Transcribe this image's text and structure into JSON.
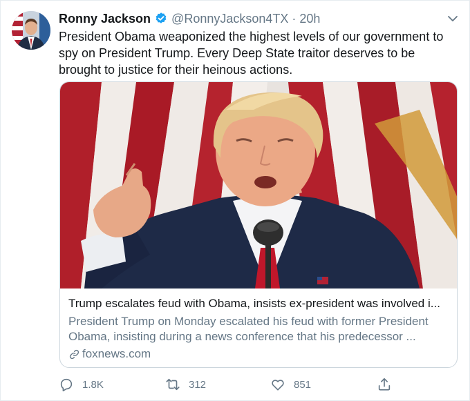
{
  "tweet": {
    "author_name": "Ronny Jackson",
    "handle": "@RonnyJackson4TX",
    "separator": "·",
    "timestamp": "20h",
    "text": "President Obama weaponized the highest levels of our government to spy on President Trump. Every Deep State traitor deserves to be brought to justice for their heinous actions."
  },
  "card": {
    "title": "Trump escalates feud with Obama, insists ex-president was involved i...",
    "description": "President Trump on Monday escalated his feud with former President Obama, insisting during a news conference that his predecessor ...",
    "domain": "foxnews.com"
  },
  "actions": {
    "replies": "1.8K",
    "retweets": "312",
    "likes": "851"
  },
  "colors": {
    "verified_badge": "#1da1f2",
    "secondary_text": "#657786",
    "primary_text": "#14171a",
    "card_border": "#ccd6dd"
  },
  "icons": {
    "verified": "verified-badge-icon",
    "caret": "chevron-down-icon",
    "link": "link-icon",
    "reply": "reply-icon",
    "retweet": "retweet-icon",
    "like": "heart-icon",
    "share": "share-icon"
  }
}
